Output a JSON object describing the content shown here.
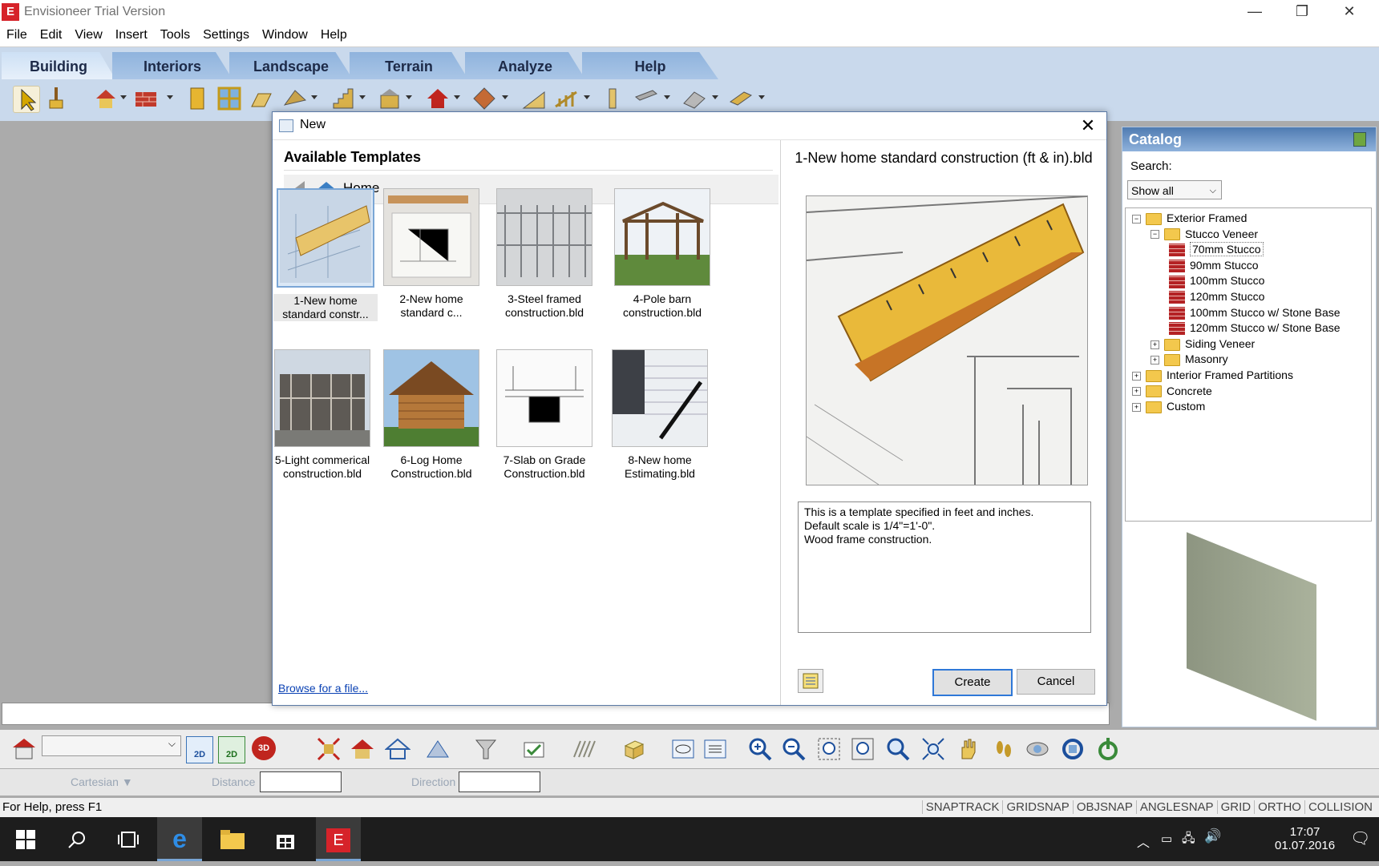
{
  "app": {
    "title": "Envisioneer Trial Version",
    "logo_letter": "E"
  },
  "window_controls": {
    "minimize": "—",
    "restore": "❐",
    "close": "✕"
  },
  "menu": [
    "File",
    "Edit",
    "View",
    "Insert",
    "Tools",
    "Settings",
    "Window",
    "Help"
  ],
  "ribbon_tabs": [
    "Building",
    "Interiors",
    "Landscape",
    "Terrain",
    "Analyze",
    "Help"
  ],
  "active_tab": "Building",
  "dialog": {
    "title": "New",
    "close": "✕",
    "available_templates_heading": "Available Templates",
    "breadcrumb": "Home",
    "templates": [
      {
        "label": "1-New home standard constr...",
        "selected": true
      },
      {
        "label": "2-New home standard c..."
      },
      {
        "label": "3-Steel framed construction.bld"
      },
      {
        "label": "4-Pole barn construction.bld"
      },
      {
        "label": "5-Light commerical construction.bld"
      },
      {
        "label": "6-Log Home Construction.bld"
      },
      {
        "label": "7-Slab on Grade Construction.bld"
      },
      {
        "label": "8-New home Estimating.bld"
      }
    ],
    "browse_link": "Browse for a file...",
    "preview_title": "1-New home standard construction (ft & in).bld",
    "description": "This is a template specified in feet and inches.\nDefault scale is 1/4\"=1'-0\".\nWood frame construction.",
    "create_label": "Create",
    "cancel_label": "Cancel"
  },
  "catalog": {
    "title": "Catalog",
    "search_label": "Search:",
    "search_value": "Show all",
    "tree": [
      {
        "label": "Exterior Framed",
        "level": 0,
        "expander": "−",
        "icon": "folder"
      },
      {
        "label": "Stucco Veneer",
        "level": 1,
        "expander": "−",
        "icon": "folder"
      },
      {
        "label": "70mm Stucco",
        "level": 2,
        "icon": "brick",
        "selected": true
      },
      {
        "label": "90mm Stucco",
        "level": 2,
        "icon": "brick"
      },
      {
        "label": "100mm Stucco",
        "level": 2,
        "icon": "brick"
      },
      {
        "label": "120mm Stucco",
        "level": 2,
        "icon": "brick"
      },
      {
        "label": "100mm Stucco w/ Stone Base",
        "level": 2,
        "icon": "brick"
      },
      {
        "label": "120mm Stucco w/ Stone Base",
        "level": 2,
        "icon": "brick"
      },
      {
        "label": "Siding Veneer",
        "level": 1,
        "expander": "+",
        "icon": "folder"
      },
      {
        "label": "Masonry",
        "level": 1,
        "expander": "+",
        "icon": "folder"
      },
      {
        "label": "Interior Framed Partitions",
        "level": 0,
        "expander": "+",
        "icon": "folder"
      },
      {
        "label": "Concrete",
        "level": 0,
        "expander": "+",
        "icon": "folder"
      },
      {
        "label": "Custom",
        "level": 0,
        "expander": "+",
        "icon": "folder"
      }
    ]
  },
  "coords": {
    "mode": "Cartesian",
    "distance_label": "Distance",
    "direction_label": "Direction"
  },
  "status": {
    "help_text": "For Help, press F1",
    "flags": [
      "SNAPTRACK",
      "GRIDSNAP",
      "OBJSNAP",
      "ANGLESNAP",
      "GRID",
      "ORTHO",
      "COLLISION"
    ]
  },
  "taskbar": {
    "time": "17:07",
    "date": "01.07.2016"
  },
  "colors": {
    "accent": "#2f78d8",
    "ribbon": "#c9d9ec",
    "catalog_header": "#4f7bb1",
    "logo_red": "#d6232a"
  }
}
